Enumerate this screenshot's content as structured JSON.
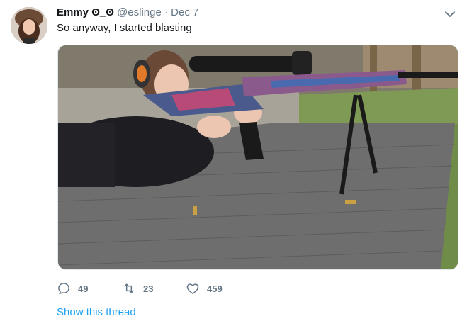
{
  "tweet": {
    "display_name": "Emmy",
    "name_emoji": "ʘ_ʘ",
    "handle": "@eslinge",
    "separator": "·",
    "date": "Dec 7",
    "text": "So anyway, I started blasting",
    "media": {
      "icon": "video-thumbnail"
    },
    "actions": {
      "reply_count": "49",
      "retweet_count": "23",
      "like_count": "459"
    },
    "show_thread_label": "Show this thread"
  },
  "colors": {
    "text_primary": "#14171a",
    "text_secondary": "#657786",
    "link": "#1da1f2",
    "border": "#e1e8ed"
  }
}
